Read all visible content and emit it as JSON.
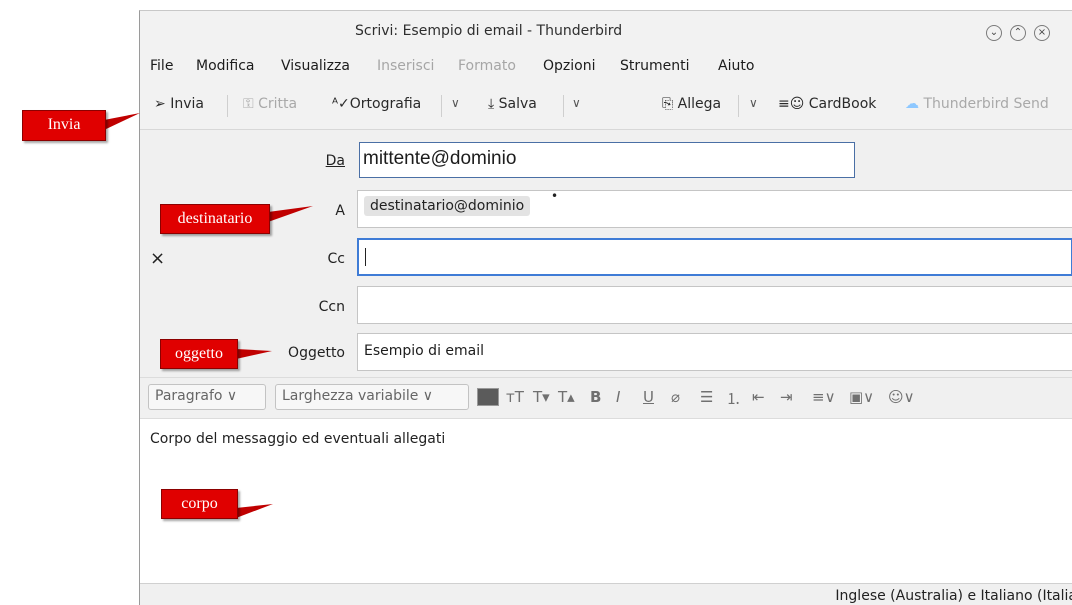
{
  "window": {
    "title": "Scrivi: Esempio di email - Thunderbird"
  },
  "menu": [
    "File",
    "Modifica",
    "Visualizza",
    "Inserisci",
    "Formato",
    "Opzioni",
    "Strumenti",
    "Aiuto"
  ],
  "toolbar": {
    "send": "Invia",
    "encrypt": "Critta",
    "spelling": "Ortografia",
    "save": "Salva",
    "attach": "Allega",
    "cardbook": "CardBook",
    "thunderbird_send": "Thunderbird Send"
  },
  "fields": {
    "from_label": "Da",
    "from_value": "mittente@dominio",
    "to_label": "A",
    "to_value": "destinatario@dominio",
    "cc_label": "Cc",
    "bcc_label": "Ccn",
    "subject_label": "Oggetto",
    "subject_value": "Esempio di email"
  },
  "format": {
    "paragraph": "Paragrafo",
    "font": "Larghezza variabile"
  },
  "body": {
    "text": "Corpo del messaggio ed eventuali allegati"
  },
  "status": {
    "language": "Inglese (Australia) e Italiano (Italia"
  },
  "callouts": {
    "send": "Invia",
    "recipient": "destinatario",
    "subject": "oggetto",
    "body": "corpo"
  },
  "icons": {
    "close": "×"
  }
}
